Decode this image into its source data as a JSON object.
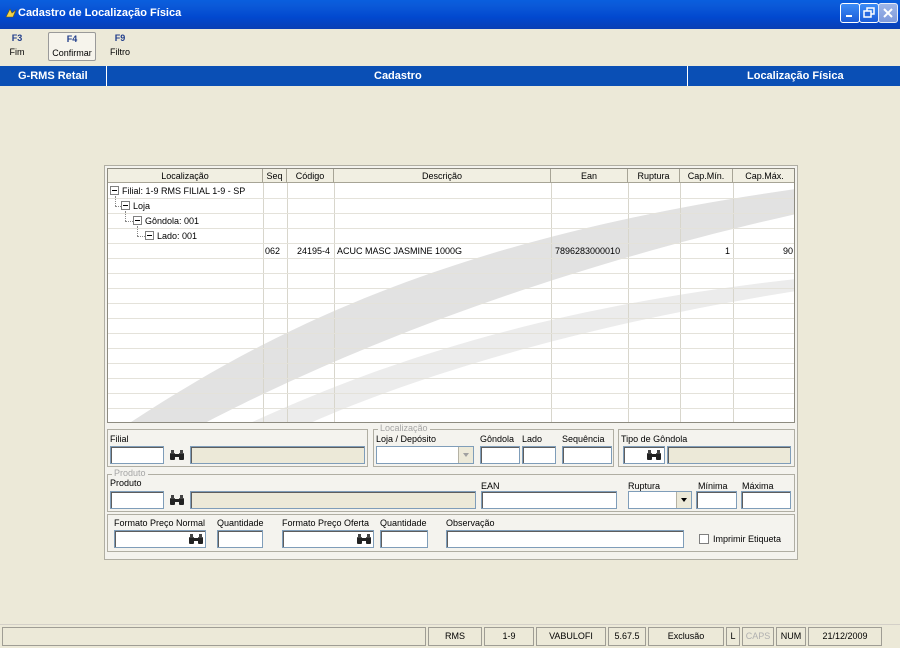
{
  "window": {
    "title": "Cadastro de Localização Física"
  },
  "toolbar": [
    {
      "key": "F3",
      "label": "Fim"
    },
    {
      "key": "F4",
      "label": "Confirmar"
    },
    {
      "key": "F9",
      "label": "Filtro"
    }
  ],
  "header": {
    "left": "G-RMS Retail",
    "center": "Cadastro",
    "right": "Localização Física"
  },
  "grid": {
    "columns": [
      "Localização",
      "Seq",
      "Código",
      "Descrição",
      "Ean",
      "Ruptura",
      "Cap.Mín.",
      "Cap.Máx."
    ],
    "tree": {
      "filial": "Filial: 1-9  RMS FILIAL 1-9 - SP",
      "loja": "Loja",
      "gondola": "Gôndola: 001",
      "lado": "Lado: 001"
    },
    "rows": [
      {
        "seq": "062",
        "codigo": "24195-4",
        "descricao": "ACUC MASC JASMINE 1000G",
        "ean": "7896283000010",
        "ruptura": "",
        "cap_min": "1",
        "cap_max": "90"
      }
    ]
  },
  "form": {
    "filial_label": "Filial",
    "localizacao_legend": "Localização",
    "loja_deposito_label": "Loja / Depósito",
    "gondola_label": "Gôndola",
    "lado_label": "Lado",
    "sequencia_label": "Sequência",
    "tipo_gondola_label": "Tipo de Gôndola",
    "produto_legend": "Produto",
    "produto_label": "Produto",
    "ean_label": "EAN",
    "ruptura_label": "Ruptura",
    "minima_label": "Mínima",
    "maxima_label": "Máxima",
    "formato_normal_label": "Formato Preço Normal",
    "quantidade_label": "Quantidade",
    "formato_oferta_label": "Formato Preço Oferta",
    "quantidade2_label": "Quantidade",
    "observacao_label": "Observação",
    "imprimir_label": "Imprimir Etiqueta"
  },
  "status": {
    "system": "RMS",
    "filial": "1-9",
    "user": "VABULOFI",
    "version": "5.67.5",
    "mode": "Exclusão",
    "l": "L",
    "caps": "CAPS",
    "num": "NUM",
    "date": "21/12/2009"
  },
  "colors": {
    "title_bar": "#0148CF",
    "header_bar": "#0A4FB5",
    "background": "#ECE9D8"
  }
}
